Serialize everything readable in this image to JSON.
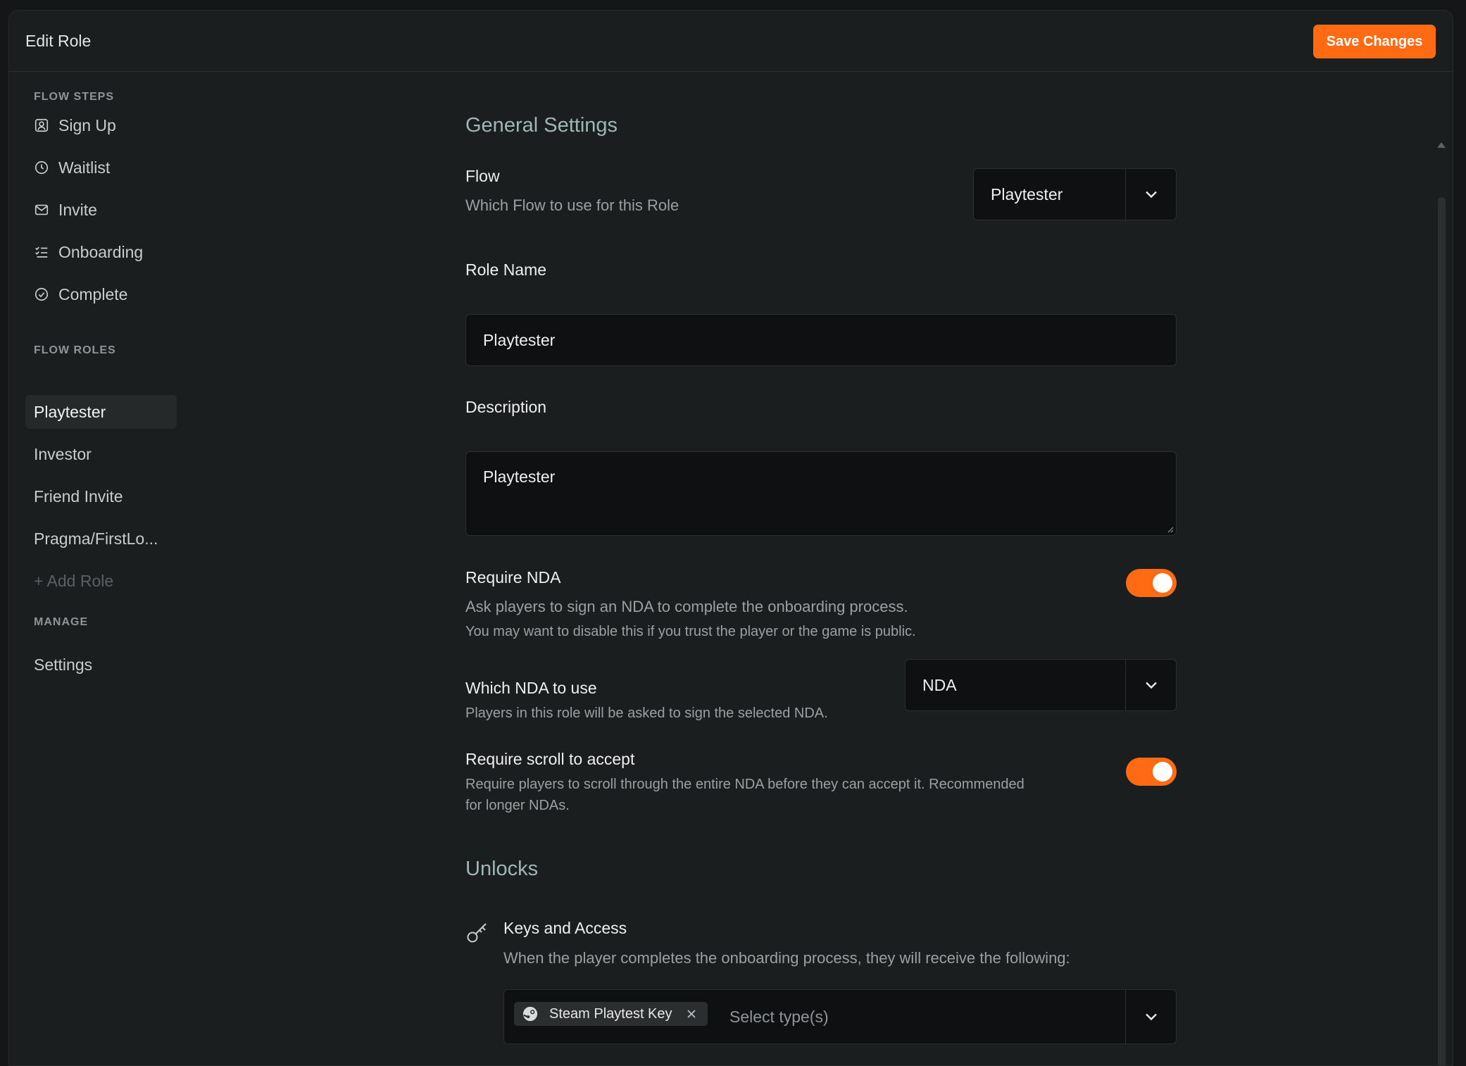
{
  "header": {
    "title": "Edit Role",
    "save_label": "Save Changes"
  },
  "sidebar": {
    "flow_steps_heading": "FLOW STEPS",
    "flow_steps": [
      {
        "label": "Sign Up",
        "icon": "user-square-icon"
      },
      {
        "label": "Waitlist",
        "icon": "clock-icon"
      },
      {
        "label": "Invite",
        "icon": "mail-icon"
      },
      {
        "label": "Onboarding",
        "icon": "checklist-icon"
      },
      {
        "label": "Complete",
        "icon": "check-circle-icon"
      }
    ],
    "flow_roles_heading": "FLOW ROLES",
    "roles": [
      "Playtester",
      "Investor",
      "Friend Invite",
      "Pragma/FirstLo..."
    ],
    "add_role_label": "+ Add Role",
    "manage_heading": "MANAGE",
    "manage_items": [
      "Settings"
    ]
  },
  "general": {
    "title": "General Settings",
    "flow_label": "Flow",
    "flow_desc": "Which Flow to use for this Role",
    "flow_value": "Playtester",
    "role_name_label": "Role Name",
    "role_name_value": "Playtester",
    "description_label": "Description",
    "description_value": "Playtester",
    "require_nda_label": "Require NDA",
    "require_nda_desc": "Ask players to sign an NDA to complete the onboarding process.",
    "require_nda_note": "You may want to disable this if you trust the player or the game is public.",
    "require_nda_on": true,
    "which_nda_label": "Which NDA to use",
    "which_nda_desc": "Players in this role will be asked to sign the selected NDA.",
    "which_nda_value": "NDA",
    "scroll_label": "Require scroll to accept",
    "scroll_desc_line1": "Require players to scroll through the entire NDA before they can accept it. Recommended",
    "scroll_desc_line2": "for longer NDAs.",
    "scroll_on": true
  },
  "unlocks": {
    "title": "Unlocks",
    "keys_label": "Keys and Access",
    "keys_desc": "When the player completes the onboarding process, they will receive the following:",
    "selected_tag": "Steam Playtest Key",
    "select_placeholder": "Select type(s)"
  },
  "colors": {
    "accent": "#ff6a13",
    "section_title": "#9fb7b2",
    "background": "#1b1e1f"
  }
}
